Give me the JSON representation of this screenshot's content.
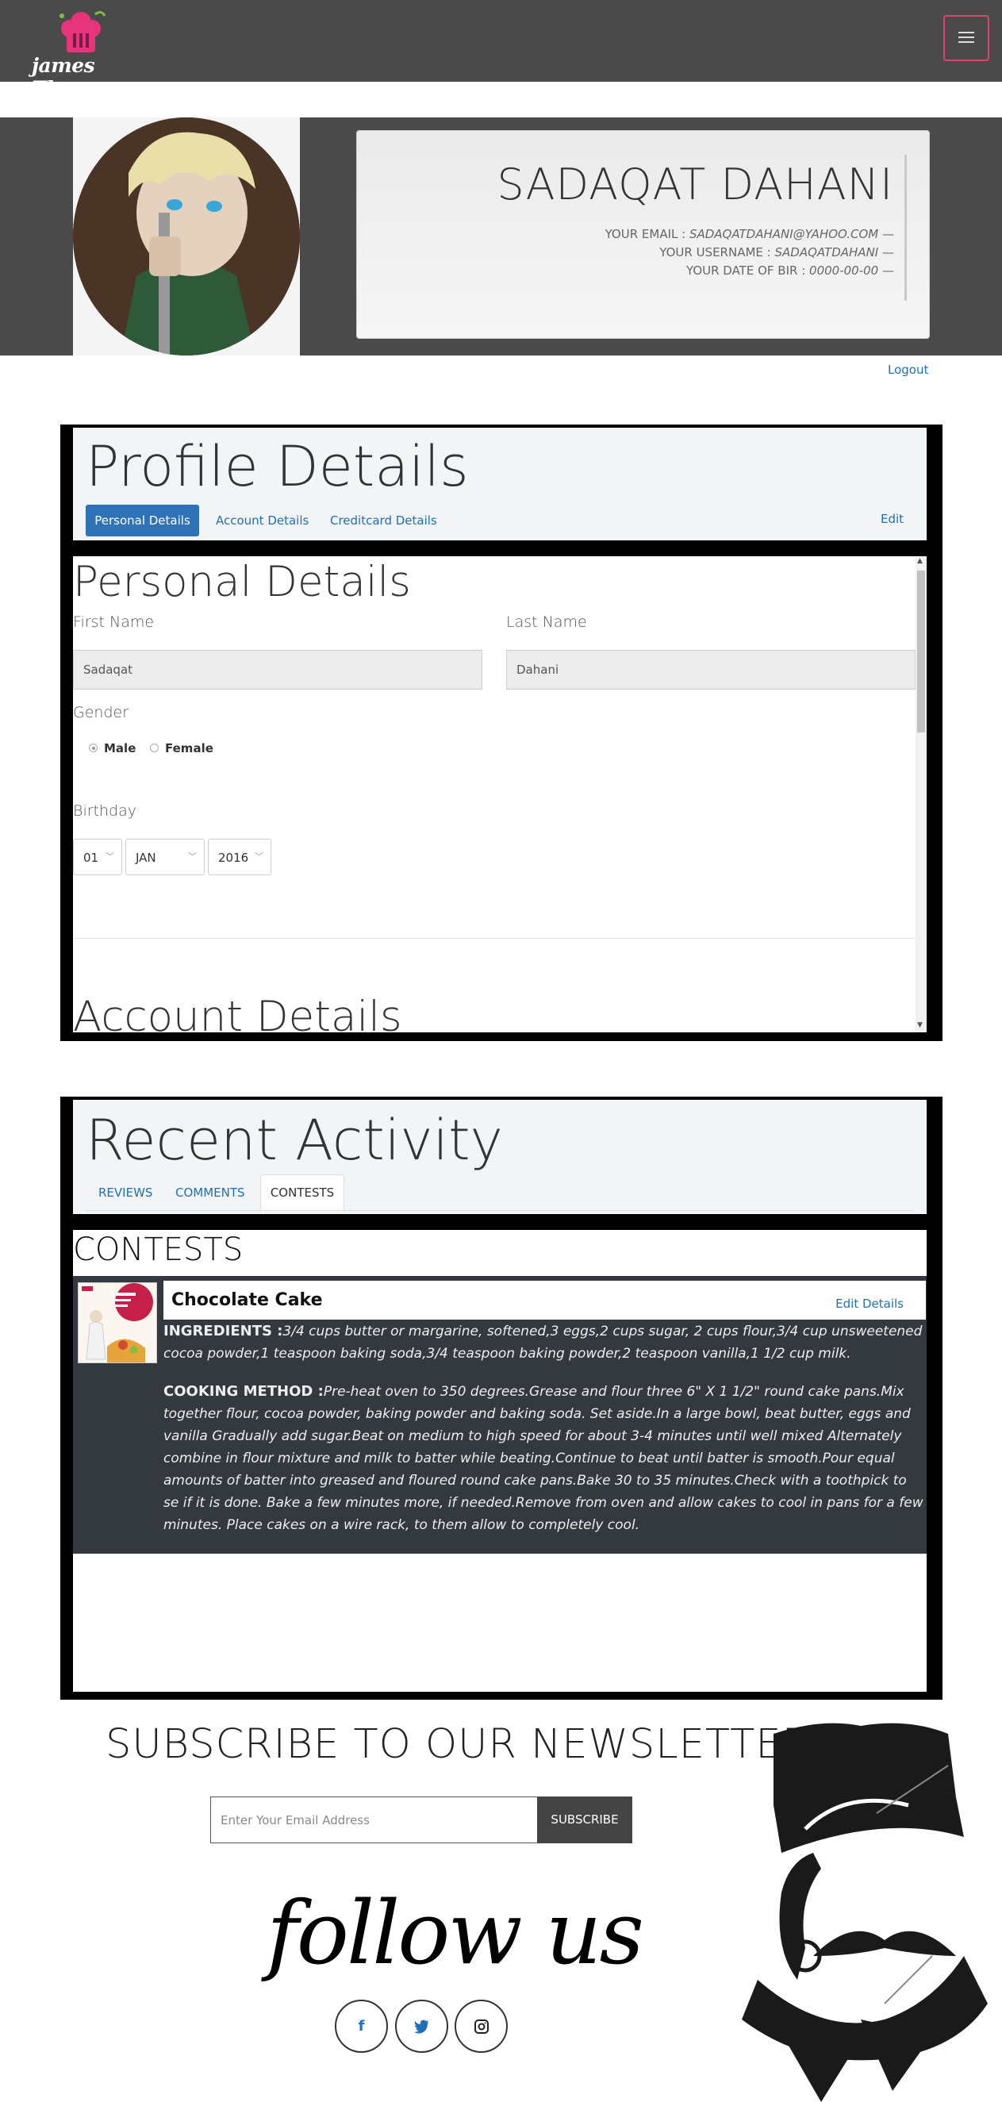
{
  "navbar": {
    "brand": "james Thew",
    "menu_icon": "hamburger-icon"
  },
  "profile": {
    "name": "SADAQAT DAHANI",
    "email_label": "YOUR EMAIL : ",
    "email": "SADAQATDAHANI@YAHOO.COM",
    "username_label": "YOUR USERNAME : ",
    "username": "SADAQATDAHANI",
    "dob_label": "YOUR DATE OF BIR : ",
    "dob": "0000-00-00",
    "dash": " —",
    "logout": "Logout"
  },
  "profile_details": {
    "title": "Profile Details",
    "tabs": [
      "Personal Details",
      "Account Details",
      "Creditcard Details"
    ],
    "edit": "Edit",
    "personal_title": "Personal Details",
    "first_name_label": "First Name",
    "first_name": "Sadaqat",
    "last_name_label": "Last Name",
    "last_name": "Dahani",
    "gender_label": "Gender",
    "gender_options": [
      "Male",
      "Female"
    ],
    "gender_selected": "Male",
    "birthday_label": "Birthday",
    "birthday_day": "01",
    "birthday_month": "JAN",
    "birthday_year": "2016",
    "account_title": "Account Details"
  },
  "recent_activity": {
    "title": "Recent Activity",
    "tabs": [
      "REVIEWS",
      "COMMENTS",
      "CONTESTS"
    ],
    "active_tab": "CONTESTS",
    "section_title": "CONTESTS",
    "contest": {
      "title": "Chocolate Cake",
      "edit": "Edit Details",
      "ingredients_label": "INGREDIENTS :",
      "ingredients": "3/4 cups butter or margarine, softened,3 eggs,2 cups sugar, 2 cups flour,3/4 cup unsweetened cocoa powder,1 teaspoon baking soda,3/4 teaspoon baking powder,2 teaspoon vanilla,1 1/2 cup milk.",
      "method_label": "COOKING METHOD :",
      "method": "Pre-heat oven to 350 degrees.Grease and flour three 6\" X 1 1/2\" round cake pans.Mix together flour, cocoa powder, baking powder and baking soda. Set aside.In a large bowl, beat butter, eggs and vanilla Gradually add sugar.Beat on medium to high speed for about 3-4 minutes until well mixed Alternately combine in flour mixture and milk to batter while beating.Continue to beat until batter is smooth.Pour equal amounts of batter into greased and floured round cake pans.Bake 30 to 35 minutes.Check with a toothpick to se if it is done. Bake a few minutes more, if needed.Remove from oven and allow cakes to cool in pans for a few minutes. Place cakes on a wire rack, to them allow to completely cool."
    }
  },
  "newsletter": {
    "title": "SUBSCRIBE TO OUR NEWSLETTER",
    "placeholder": "Enter Your Email Address",
    "button": "SUBSCRIBE"
  },
  "follow": {
    "title": "follow us",
    "icons": [
      "facebook-icon",
      "twitter-icon",
      "instagram-icon"
    ]
  },
  "colors": {
    "nav_bg": "#4a4a4a",
    "accent": "#1e6fb8",
    "toggle_border": "#d9466f",
    "contest_bg": "#33393e"
  }
}
